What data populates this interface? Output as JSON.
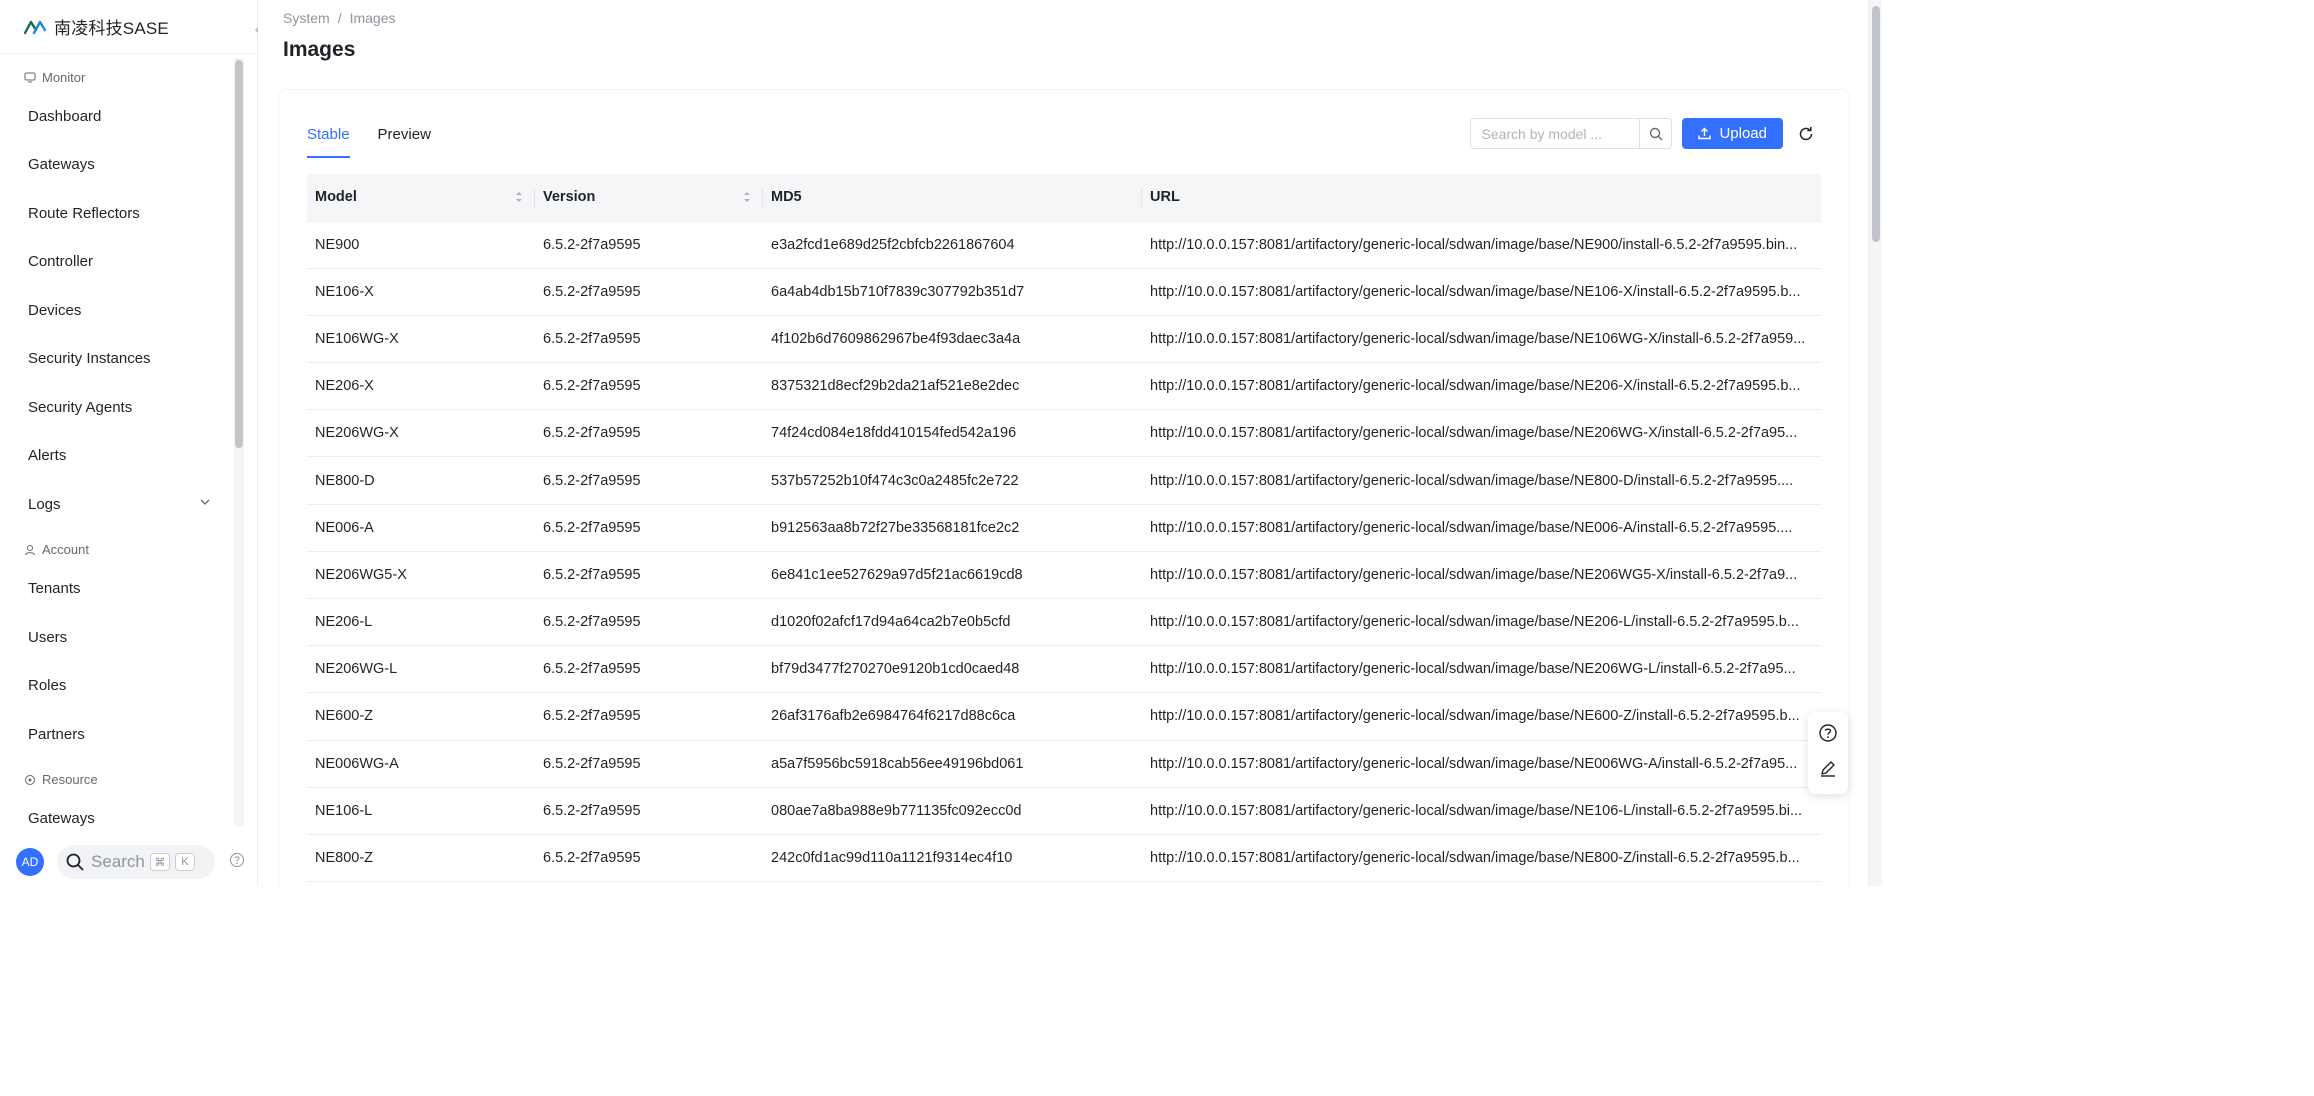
{
  "brand": {
    "name": "南凌科技SASE"
  },
  "sidebar": {
    "groups": [
      {
        "label": "Monitor",
        "icon": "monitor-icon"
      },
      {
        "label": "Account",
        "icon": "user-icon"
      },
      {
        "label": "Resource",
        "icon": "resource-icon"
      }
    ],
    "monitor_items": [
      "Dashboard",
      "Gateways",
      "Route Reflectors",
      "Controller",
      "Devices",
      "Security Instances",
      "Security Agents",
      "Alerts",
      "Logs"
    ],
    "account_items": [
      "Tenants",
      "Users",
      "Roles",
      "Partners"
    ],
    "resource_items": [
      "Gateways"
    ]
  },
  "footer": {
    "avatar_initials": "AD",
    "search_label": "Search",
    "kbd_cmd": "⌘",
    "kbd_key": "K"
  },
  "breadcrumb": {
    "parent": "System",
    "sep": "/",
    "current": "Images"
  },
  "page": {
    "title": "Images"
  },
  "tabs": [
    "Stable",
    "Preview"
  ],
  "toolbar": {
    "search_placeholder": "Search by model ...",
    "upload_label": "Upload"
  },
  "table": {
    "columns": [
      "Model",
      "Version",
      "MD5",
      "URL"
    ],
    "rows": [
      [
        "NE900",
        "6.5.2-2f7a9595",
        "e3a2fcd1e689d25f2cbfcb2261867604",
        "http://10.0.0.157:8081/artifactory/generic-local/sdwan/image/base/NE900/install-6.5.2-2f7a9595.bin..."
      ],
      [
        "NE106-X",
        "6.5.2-2f7a9595",
        "6a4ab4db15b710f7839c307792b351d7",
        "http://10.0.0.157:8081/artifactory/generic-local/sdwan/image/base/NE106-X/install-6.5.2-2f7a9595.b..."
      ],
      [
        "NE106WG-X",
        "6.5.2-2f7a9595",
        "4f102b6d7609862967be4f93daec3a4a",
        "http://10.0.0.157:8081/artifactory/generic-local/sdwan/image/base/NE106WG-X/install-6.5.2-2f7a959..."
      ],
      [
        "NE206-X",
        "6.5.2-2f7a9595",
        "8375321d8ecf29b2da21af521e8e2dec",
        "http://10.0.0.157:8081/artifactory/generic-local/sdwan/image/base/NE206-X/install-6.5.2-2f7a9595.b..."
      ],
      [
        "NE206WG-X",
        "6.5.2-2f7a9595",
        "74f24cd084e18fdd410154fed542a196",
        "http://10.0.0.157:8081/artifactory/generic-local/sdwan/image/base/NE206WG-X/install-6.5.2-2f7a95..."
      ],
      [
        "NE800-D",
        "6.5.2-2f7a9595",
        "537b57252b10f474c3c0a2485fc2e722",
        "http://10.0.0.157:8081/artifactory/generic-local/sdwan/image/base/NE800-D/install-6.5.2-2f7a9595...."
      ],
      [
        "NE006-A",
        "6.5.2-2f7a9595",
        "b912563aa8b72f27be33568181fce2c2",
        "http://10.0.0.157:8081/artifactory/generic-local/sdwan/image/base/NE006-A/install-6.5.2-2f7a9595...."
      ],
      [
        "NE206WG5-X",
        "6.5.2-2f7a9595",
        "6e841c1ee527629a97d5f21ac6619cd8",
        "http://10.0.0.157:8081/artifactory/generic-local/sdwan/image/base/NE206WG5-X/install-6.5.2-2f7a9..."
      ],
      [
        "NE206-L",
        "6.5.2-2f7a9595",
        "d1020f02afcf17d94a64ca2b7e0b5cfd",
        "http://10.0.0.157:8081/artifactory/generic-local/sdwan/image/base/NE206-L/install-6.5.2-2f7a9595.b..."
      ],
      [
        "NE206WG-L",
        "6.5.2-2f7a9595",
        "bf79d3477f270270e9120b1cd0caed48",
        "http://10.0.0.157:8081/artifactory/generic-local/sdwan/image/base/NE206WG-L/install-6.5.2-2f7a95..."
      ],
      [
        "NE600-Z",
        "6.5.2-2f7a9595",
        "26af3176afb2e6984764f6217d88c6ca",
        "http://10.0.0.157:8081/artifactory/generic-local/sdwan/image/base/NE600-Z/install-6.5.2-2f7a9595.b..."
      ],
      [
        "NE006WG-A",
        "6.5.2-2f7a9595",
        "a5a7f5956bc5918cab56ee49196bd061",
        "http://10.0.0.157:8081/artifactory/generic-local/sdwan/image/base/NE006WG-A/install-6.5.2-2f7a95..."
      ],
      [
        "NE106-L",
        "6.5.2-2f7a9595",
        "080ae7a8ba988e9b771135fc092ecc0d",
        "http://10.0.0.157:8081/artifactory/generic-local/sdwan/image/base/NE106-L/install-6.5.2-2f7a9595.bi..."
      ],
      [
        "NE800-Z",
        "6.5.2-2f7a9595",
        "242c0fd1ac99d110a1121f9314ec4f10",
        "http://10.0.0.157:8081/artifactory/generic-local/sdwan/image/base/NE800-Z/install-6.5.2-2f7a9595.b..."
      ]
    ]
  },
  "colors": {
    "accent": "#3370ff",
    "text": "#1f2329",
    "muted": "#8f959e",
    "header_bg": "#f5f6f7"
  }
}
